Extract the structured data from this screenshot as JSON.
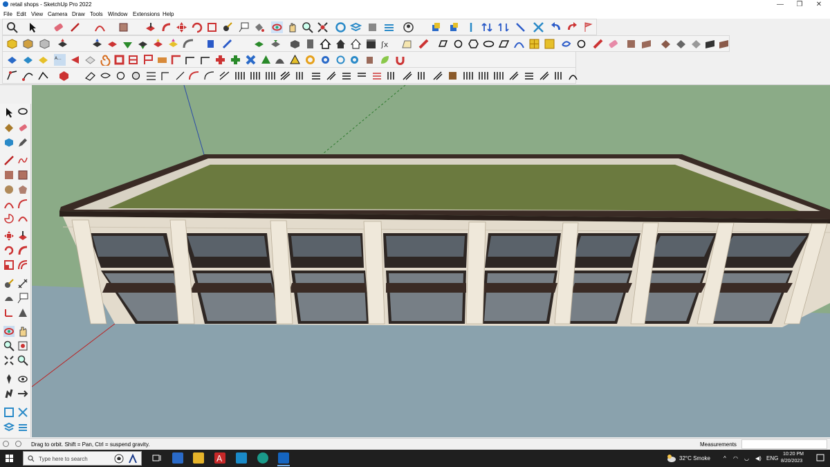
{
  "window": {
    "title": "retail shops - SketchUp Pro 2022",
    "minimize": "—",
    "maximize": "❐",
    "close": "✕"
  },
  "menu": [
    "File",
    "Edit",
    "View",
    "Camera",
    "Draw",
    "Tools",
    "Window",
    "Extensions",
    "Help"
  ],
  "status": {
    "hint": "Drag to orbit. Shift = Pan, Ctrl = suspend gravity.",
    "measurements_label": "Measurements",
    "measurements_value": ""
  },
  "taskbar": {
    "search_placeholder": "Type here to search",
    "weather": "32°C  Smoke",
    "language": "ENG",
    "time": "10:20 PM",
    "date": "8/20/2023"
  },
  "colors": {
    "sky": "#8bab87",
    "ground": "#8aa2ad",
    "roof": "#6b7a3f",
    "facade": "#e3dbcc",
    "trim": "#3a2b25"
  }
}
